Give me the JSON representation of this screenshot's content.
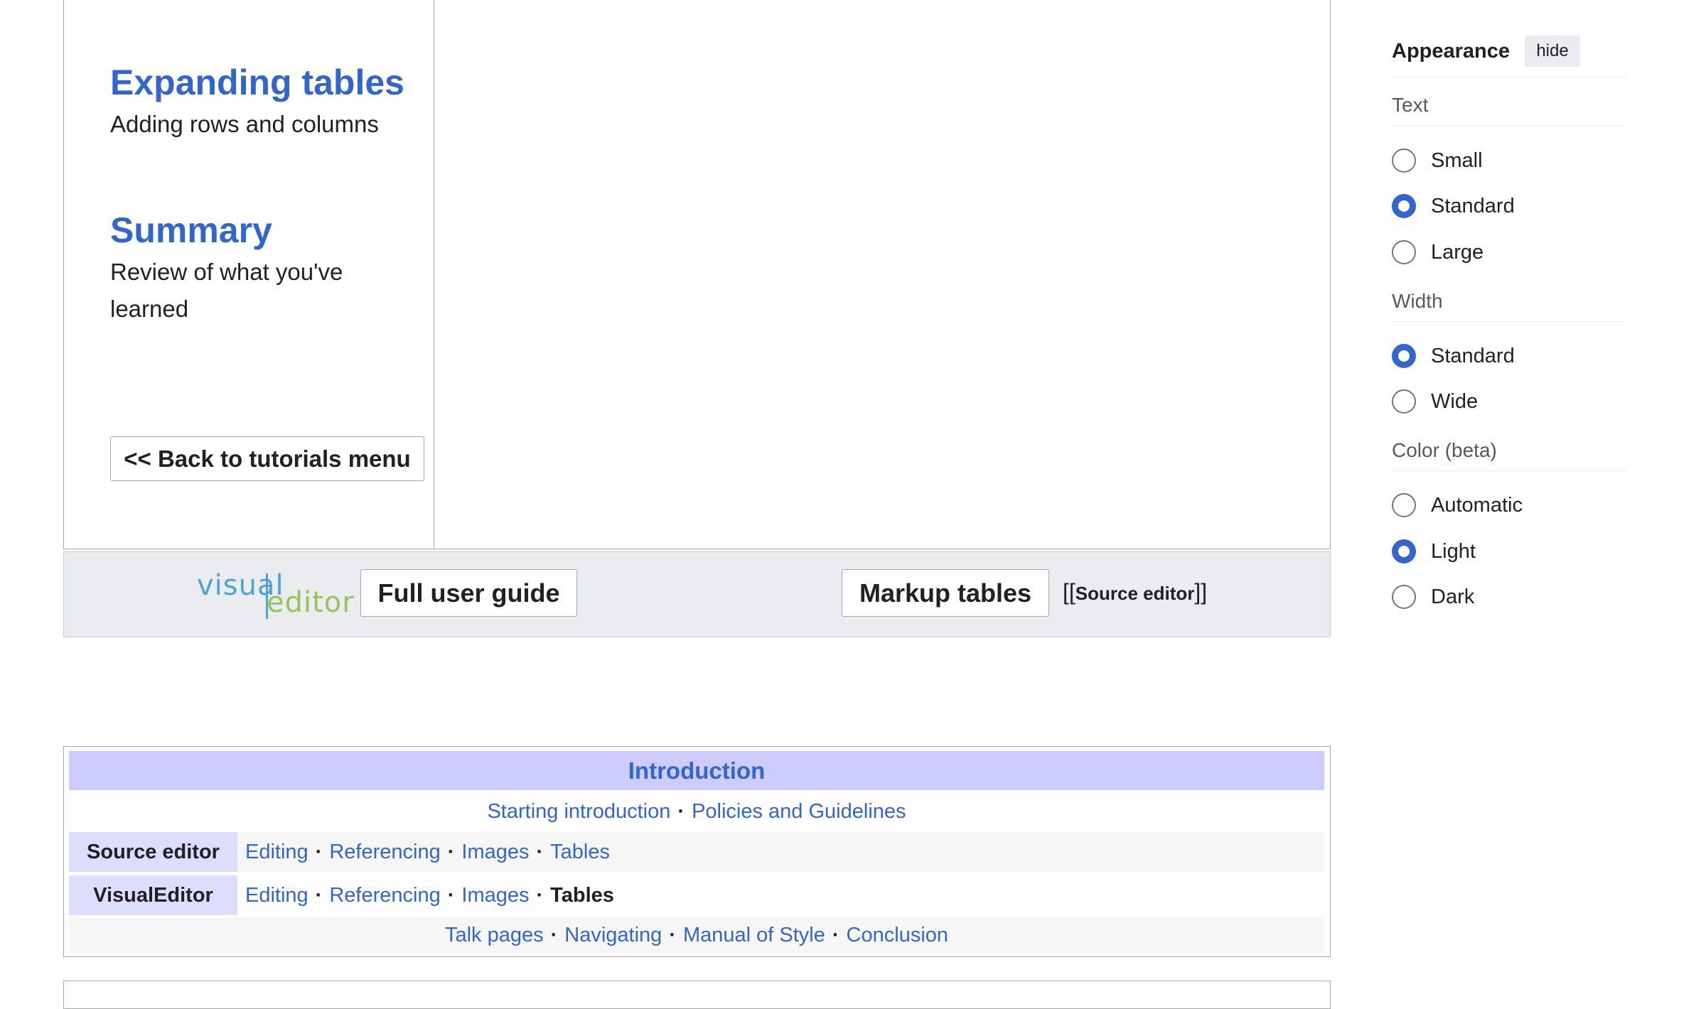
{
  "tutorial": {
    "sections": [
      {
        "title": "Expanding tables",
        "subtitle": "Adding rows and columns"
      },
      {
        "title": "Summary",
        "subtitle": "Review of what you've learned"
      }
    ],
    "back_button": "<< Back to tutorials menu"
  },
  "bar": {
    "logo_word_1": "visual",
    "logo_word_2": "editor",
    "full_guide_button": "Full user guide",
    "markup_tables_button": "Markup tables",
    "source_open": "[[",
    "source_label": "Source editor",
    "source_close": "]]"
  },
  "navbox": {
    "title": "Introduction",
    "intro_links": [
      "Starting introduction",
      "Policies and Guidelines"
    ],
    "rows": [
      {
        "group": "Source editor",
        "links": [
          "Editing",
          "Referencing",
          "Images",
          "Tables"
        ]
      },
      {
        "group": "VisualEditor",
        "links": [
          "Editing",
          "Referencing",
          "Images"
        ],
        "current": "Tables"
      }
    ],
    "bottom_links": [
      "Talk pages",
      "Navigating",
      "Manual of Style",
      "Conclusion"
    ],
    "separator": "·"
  },
  "appearance": {
    "title": "Appearance",
    "hide_button": "hide",
    "text_label": "Text",
    "text_options": [
      "Small",
      "Standard",
      "Large"
    ],
    "text_selected": "Standard",
    "width_label": "Width",
    "width_options": [
      "Standard",
      "Wide"
    ],
    "width_selected": "Standard",
    "color_label": "Color (beta)",
    "color_options": [
      "Automatic",
      "Light",
      "Dark"
    ],
    "color_selected": "Light",
    "accent_color": "#3366cc"
  }
}
